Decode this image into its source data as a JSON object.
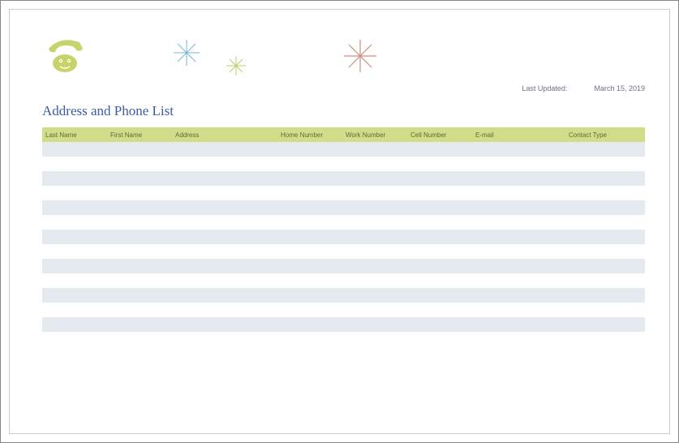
{
  "header": {
    "last_updated_label": "Last Updated:",
    "last_updated_value": "March 15, 2019",
    "title": "Address and Phone List"
  },
  "table": {
    "columns": {
      "last_name": "Last Name",
      "first_name": "First Name",
      "address": "Address",
      "home_number": "Home Number",
      "work_number": "Work Number",
      "cell_number": "Cell Number",
      "email": "E-mail",
      "contact_type": "Contact Type"
    },
    "rows": [
      {
        "last_name": "",
        "first_name": "",
        "address": "",
        "home_number": "",
        "work_number": "",
        "cell_number": "",
        "email": "",
        "contact_type": ""
      },
      {
        "last_name": "",
        "first_name": "",
        "address": "",
        "home_number": "",
        "work_number": "",
        "cell_number": "",
        "email": "",
        "contact_type": ""
      },
      {
        "last_name": "",
        "first_name": "",
        "address": "",
        "home_number": "",
        "work_number": "",
        "cell_number": "",
        "email": "",
        "contact_type": ""
      },
      {
        "last_name": "",
        "first_name": "",
        "address": "",
        "home_number": "",
        "work_number": "",
        "cell_number": "",
        "email": "",
        "contact_type": ""
      },
      {
        "last_name": "",
        "first_name": "",
        "address": "",
        "home_number": "",
        "work_number": "",
        "cell_number": "",
        "email": "",
        "contact_type": ""
      },
      {
        "last_name": "",
        "first_name": "",
        "address": "",
        "home_number": "",
        "work_number": "",
        "cell_number": "",
        "email": "",
        "contact_type": ""
      },
      {
        "last_name": "",
        "first_name": "",
        "address": "",
        "home_number": "",
        "work_number": "",
        "cell_number": "",
        "email": "",
        "contact_type": ""
      }
    ]
  },
  "decor": {
    "phone_color": "#c8d36c",
    "star1_color": "#7bb5d6",
    "star2_color": "#c0cd6a",
    "star3_color": "#d28b7d"
  }
}
